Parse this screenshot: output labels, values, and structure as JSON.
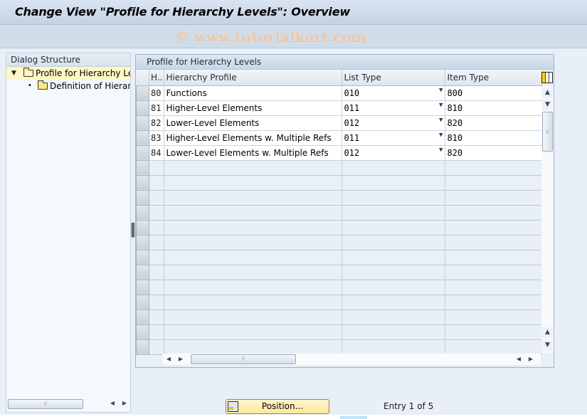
{
  "window": {
    "title": "Change View \"Profile for Hierarchy Levels\": Overview",
    "watermark": "© www.tutorialkart.com"
  },
  "dialog_structure": {
    "header": "Dialog Structure",
    "items": [
      {
        "label": "Profile for Hierarchy Levels",
        "display": "Profile for Hierarchy Leve",
        "expanded": true,
        "selected": true,
        "icon": "folder-open-icon"
      },
      {
        "label": "Definition of Hierarchy",
        "display": "Definition of Hierarch",
        "expanded": false,
        "selected": false,
        "icon": "folder-icon"
      }
    ]
  },
  "table": {
    "title": "Profile for Hierarchy Levels",
    "columns": [
      "H..",
      "Hierarchy Profile",
      "List Type",
      "Item Type"
    ],
    "rows": [
      {
        "h": "80",
        "profile": "Functions",
        "list_type": "010",
        "item_type": "800"
      },
      {
        "h": "81",
        "profile": "Higher-Level Elements",
        "list_type": "011",
        "item_type": "810"
      },
      {
        "h": "82",
        "profile": "Lower-Level Elements",
        "list_type": "012",
        "item_type": "820"
      },
      {
        "h": "83",
        "profile": "Higher-Level Elements w. Multiple Refs",
        "list_type": "011",
        "item_type": "810"
      },
      {
        "h": "84",
        "profile": "Lower-Level Elements w. Multiple Refs",
        "list_type": "012",
        "item_type": "820"
      }
    ],
    "empty_rows": 13
  },
  "footer": {
    "position_button": "Position...",
    "entry_text": "Entry 1 of 5"
  },
  "glyphs": {
    "expand": "▼",
    "bullet": "•",
    "dropdown": "▼",
    "up": "▲",
    "down": "▼",
    "left": "◀",
    "right": "▶",
    "grip": "⠿"
  }
}
